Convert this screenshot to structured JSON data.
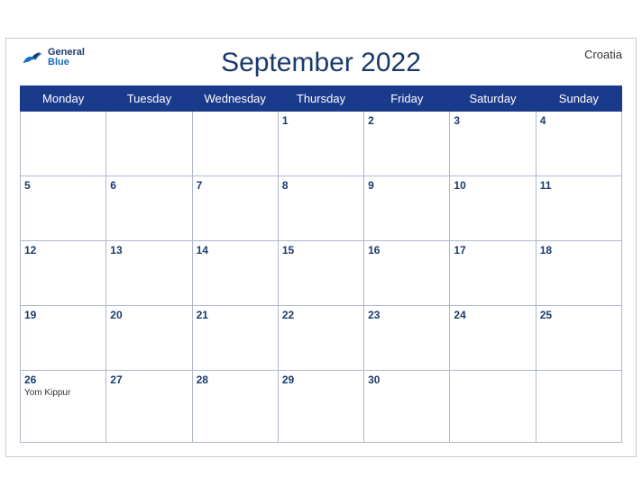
{
  "header": {
    "title": "September 2022",
    "country": "Croatia",
    "logo": {
      "general": "General",
      "blue": "Blue"
    }
  },
  "weekdays": [
    "Monday",
    "Tuesday",
    "Wednesday",
    "Thursday",
    "Friday",
    "Saturday",
    "Sunday"
  ],
  "weeks": [
    [
      {
        "date": "",
        "events": []
      },
      {
        "date": "",
        "events": []
      },
      {
        "date": "",
        "events": []
      },
      {
        "date": "1",
        "events": []
      },
      {
        "date": "2",
        "events": []
      },
      {
        "date": "3",
        "events": []
      },
      {
        "date": "4",
        "events": []
      }
    ],
    [
      {
        "date": "5",
        "events": []
      },
      {
        "date": "6",
        "events": []
      },
      {
        "date": "7",
        "events": []
      },
      {
        "date": "8",
        "events": []
      },
      {
        "date": "9",
        "events": []
      },
      {
        "date": "10",
        "events": []
      },
      {
        "date": "11",
        "events": []
      }
    ],
    [
      {
        "date": "12",
        "events": []
      },
      {
        "date": "13",
        "events": []
      },
      {
        "date": "14",
        "events": []
      },
      {
        "date": "15",
        "events": []
      },
      {
        "date": "16",
        "events": []
      },
      {
        "date": "17",
        "events": []
      },
      {
        "date": "18",
        "events": []
      }
    ],
    [
      {
        "date": "19",
        "events": []
      },
      {
        "date": "20",
        "events": []
      },
      {
        "date": "21",
        "events": []
      },
      {
        "date": "22",
        "events": []
      },
      {
        "date": "23",
        "events": []
      },
      {
        "date": "24",
        "events": []
      },
      {
        "date": "25",
        "events": []
      }
    ],
    [
      {
        "date": "26",
        "events": [
          "Yom Kippur"
        ]
      },
      {
        "date": "27",
        "events": []
      },
      {
        "date": "28",
        "events": []
      },
      {
        "date": "29",
        "events": []
      },
      {
        "date": "30",
        "events": []
      },
      {
        "date": "",
        "events": []
      },
      {
        "date": "",
        "events": []
      }
    ]
  ]
}
